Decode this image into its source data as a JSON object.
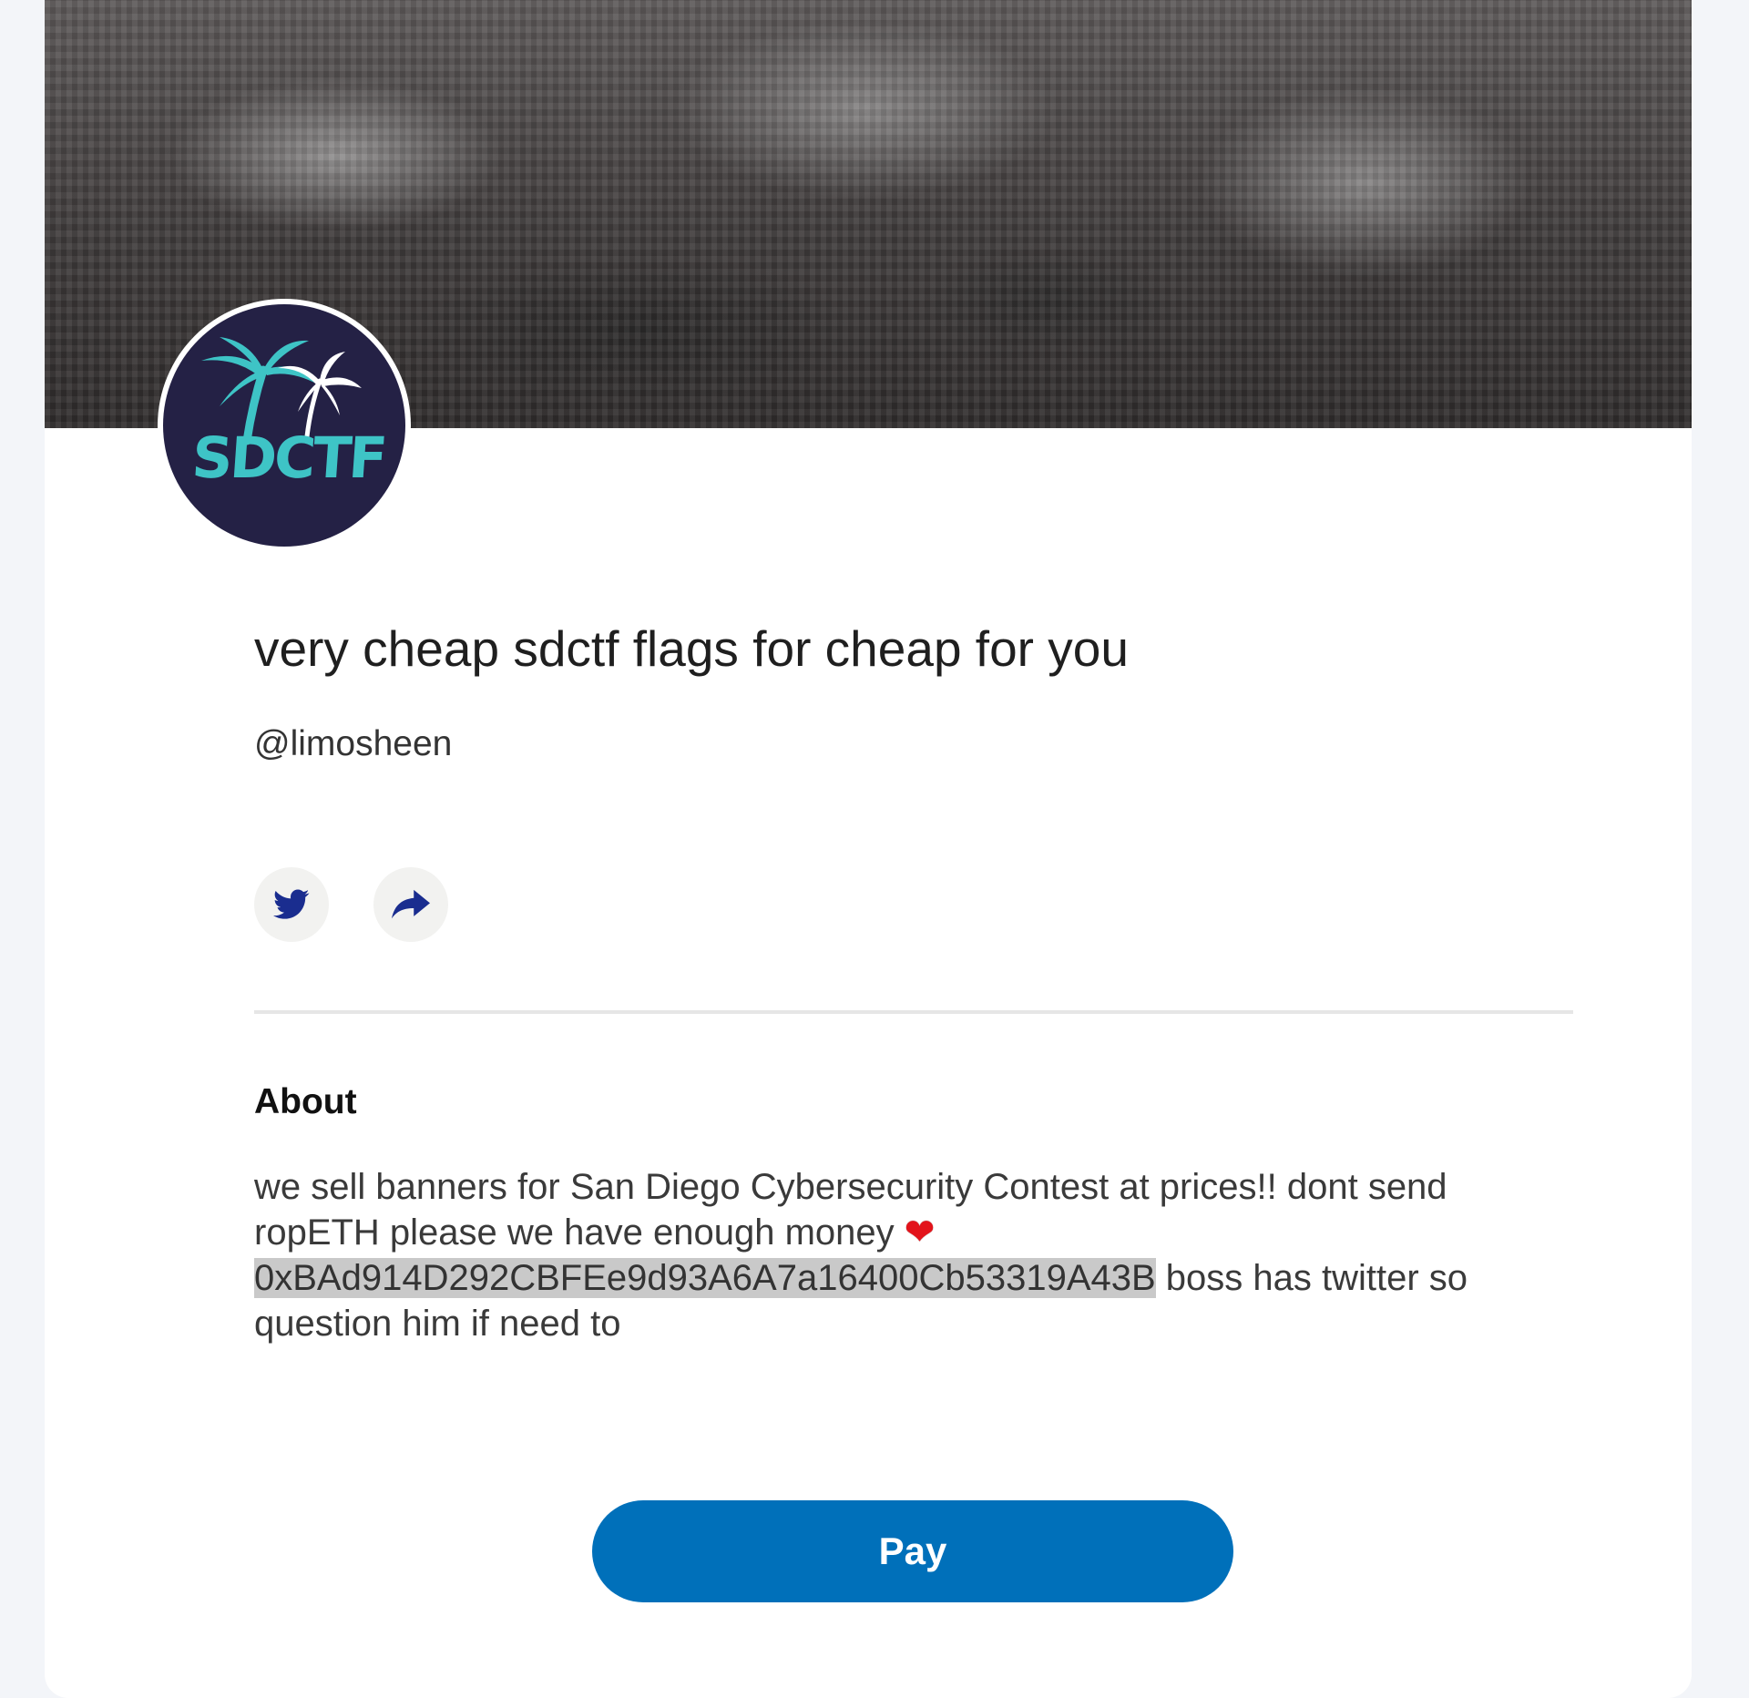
{
  "profile": {
    "title": "very cheap sdctf flags for cheap for you",
    "handle": "@limosheen",
    "avatar_text": "SDCTF"
  },
  "about": {
    "heading": "About",
    "text_before": "we sell banners for San Diego Cybersecurity Contest at prices!! dont send ropETH please we have enough money ",
    "heart": "❤",
    "address": "0xBAd914D292CBFEe9d93A6A7a16400Cb53319A43B",
    "text_after": " boss has twitter so question him if need to"
  },
  "actions": {
    "pay_label": "Pay",
    "twitter_icon": "twitter-icon",
    "share_icon": "share-icon"
  },
  "colors": {
    "pay_button": "#0070ba",
    "icon": "#1a2d8f",
    "avatar_bg": "#242145",
    "avatar_accent": "#3ec4c6"
  }
}
